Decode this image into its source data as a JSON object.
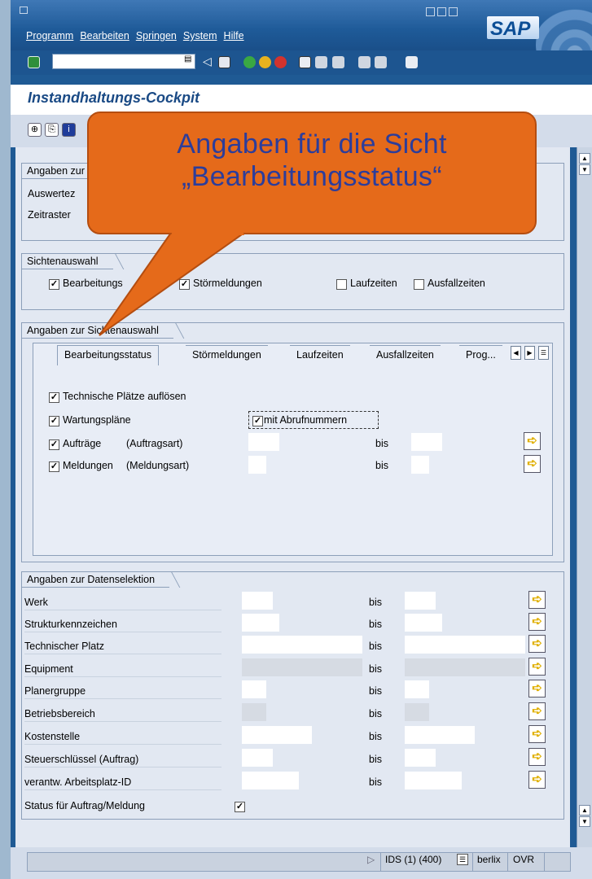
{
  "menu": [
    "Programm",
    "Bearbeiten",
    "Springen",
    "System",
    "Hilfe"
  ],
  "logo": "SAP",
  "app_title": "Instandhaltungs-Cockpit",
  "groups": {
    "angaben_zur": {
      "title": "Angaben zur",
      "rows": [
        "Auswertez",
        "Zeitraster"
      ]
    },
    "sichtenauswahl": {
      "title": "Sichtenauswahl",
      "items": [
        {
          "label": "Bearbeitungs",
          "checked": true
        },
        {
          "label": "Störmeldungen",
          "checked": true
        },
        {
          "label": "Laufzeiten",
          "checked": false
        },
        {
          "label": "Ausfallzeiten",
          "checked": false
        }
      ]
    },
    "angaben_sichtenauswahl": {
      "title": "Angaben zur Sichtenauswahl",
      "tabs": [
        "Bearbeitungsstatus",
        "Störmeldungen",
        "Laufzeiten",
        "Ausfallzeiten",
        "Prog..."
      ],
      "options": {
        "tech_plaetze": "Technische Plätze auflösen",
        "wartungsplaene": "Wartungspläne",
        "mit_abrufnummern": "mit Abrufnummern",
        "auftraege": "Aufträge",
        "auftragsart": "(Auftragsart)",
        "meldungen": "Meldungen",
        "meldungsart": "(Meldungsart)",
        "bis": "bis"
      }
    },
    "datenselektion": {
      "title": "Angaben zur Datenselektion",
      "bis": "bis",
      "rows": [
        "Werk",
        "Strukturkennzeichen",
        "Technischer Platz",
        "Equipment",
        "Planergruppe",
        "Betriebsbereich",
        "Kostenstelle",
        "Steuerschlüssel (Auftrag)",
        "verantw. Arbeitsplatz-ID"
      ],
      "status_label": "Status für Auftrag/Meldung",
      "status_checked": true
    }
  },
  "status_bar": {
    "system": "IDS (1) (400)",
    "server": "berlix",
    "mode": "OVR"
  },
  "callout": {
    "line1": "Angaben für die Sicht",
    "line2": "„Bearbeitungsstatus“"
  },
  "colors": {
    "frame_blue": "#1f5a94",
    "content_bg": "#e2e8f2",
    "callout_orange": "#e56a1a",
    "callout_text": "#2c3d9b"
  }
}
